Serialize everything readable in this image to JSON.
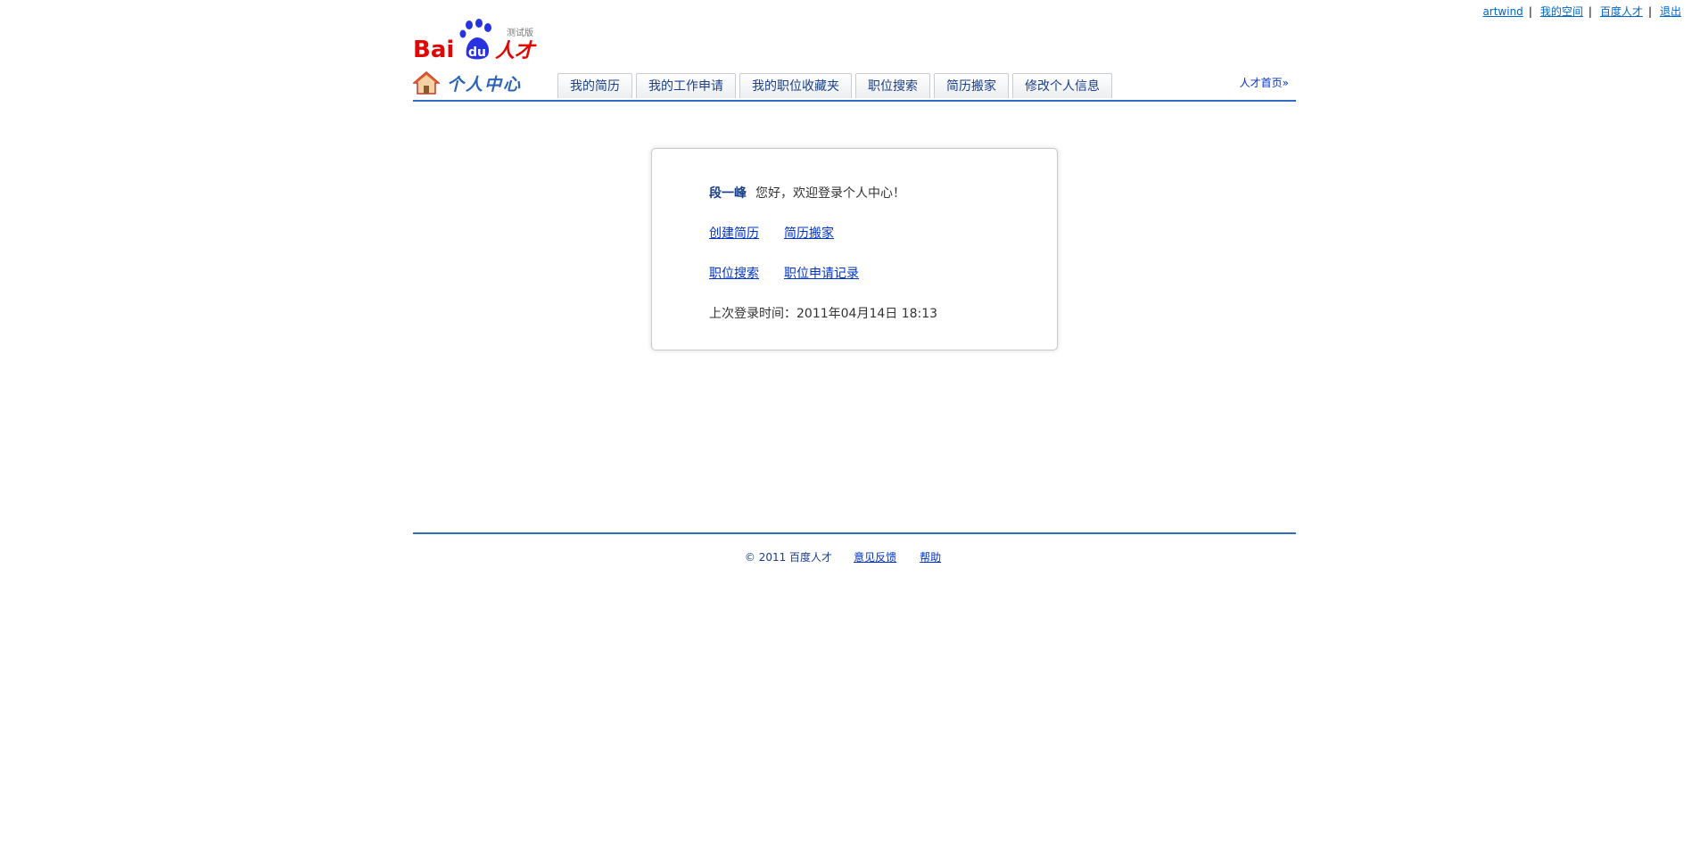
{
  "top_links": {
    "username": "artwind",
    "my_space": "我的空间",
    "baidu_talent": "百度人才",
    "logout": "退出"
  },
  "logo": {
    "text_bai": "Bai",
    "text_du": "du",
    "text_talent": "人才",
    "test_tag": "测试版"
  },
  "header": {
    "title": "个人中心",
    "home_link": "人才首页",
    "home_link_arrow": "»"
  },
  "tabs": [
    {
      "label": "我的简历"
    },
    {
      "label": "我的工作申请"
    },
    {
      "label": "我的职位收藏夹"
    },
    {
      "label": "职位搜索"
    },
    {
      "label": "简历搬家"
    },
    {
      "label": "修改个人信息"
    }
  ],
  "welcome": {
    "user_name": "段一峰",
    "greeting": "您好，欢迎登录个人中心！",
    "create_resume": "创建简历",
    "resume_move": "简历搬家",
    "job_search": "职位搜索",
    "application_record": "职位申请记录",
    "last_login_label": "上次登录时间：",
    "last_login_time": "2011年04月14日 18:13"
  },
  "footer": {
    "copyright": "© 2011 百度人才",
    "feedback": "意见反馈",
    "help": "帮助"
  },
  "colors": {
    "accent": "#2f6dc2",
    "link": "#0033cc",
    "baidu_red": "#e10602",
    "baidu_blue": "#2932e1"
  }
}
